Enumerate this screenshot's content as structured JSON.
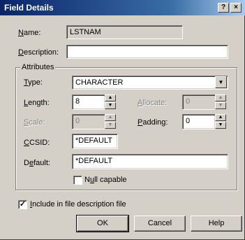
{
  "window": {
    "title": "Field Details",
    "help_button": "?",
    "close_button": "×"
  },
  "form": {
    "name_label": "Name:",
    "name_value": "LSTNAM",
    "description_label": "Description:",
    "description_value": "",
    "attributes_group": "Attributes",
    "type_label": "Type:",
    "type_value": "CHARACTER",
    "length_label": "Length:",
    "length_value": "8",
    "allocate_label": "Allocate:",
    "allocate_value": "0",
    "scale_label": "Scale:",
    "scale_value": "0",
    "padding_label": "Padding:",
    "padding_value": "0",
    "ccsid_label": "CCSID:",
    "ccsid_value": "*DEFAULT",
    "default_label": "Default:",
    "default_value": "*DEFAULT",
    "null_capable_label": "Null capable",
    "null_capable_checked": false,
    "include_label": "Include in file description file",
    "include_checked": true
  },
  "buttons": {
    "ok": "OK",
    "cancel": "Cancel",
    "help": "Help"
  },
  "icons": {
    "spin_up": "spin-up-arrow-icon",
    "spin_down": "spin-down-arrow-icon",
    "combo": "chevron-down-icon",
    "check": "checkmark-icon"
  }
}
